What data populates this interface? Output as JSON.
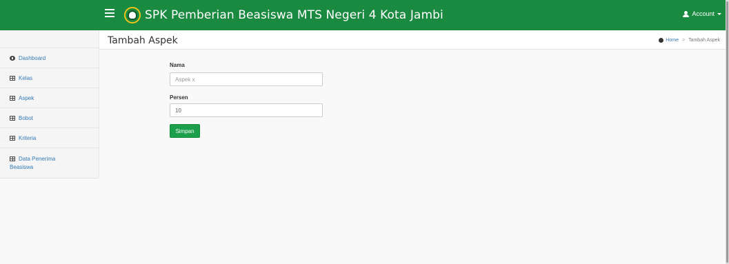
{
  "header": {
    "app_title": "SPK Pemberian Beasiswa MTS Negeri 4 Kota Jambi",
    "account_label": "Account",
    "brand_color": "#1b8a41"
  },
  "sidebar": {
    "items": [
      {
        "label": "Dashboard",
        "icon": "dashboard-icon"
      },
      {
        "label": "Kelas",
        "icon": "table-icon"
      },
      {
        "label": "Aspek",
        "icon": "table-icon"
      },
      {
        "label": "Bobot",
        "icon": "table-icon"
      },
      {
        "label": "Kriteria",
        "icon": "table-icon"
      },
      {
        "label_line1": "Data Penerima",
        "label_line2": "Beasiswa",
        "icon": "table-icon"
      }
    ]
  },
  "page": {
    "title": "Tambah Aspek",
    "breadcrumb": {
      "home": "Home",
      "separator": ">",
      "current": "Tambah Aspek"
    }
  },
  "form": {
    "nama_label": "Nama",
    "nama_placeholder": "Aspek x",
    "persen_label": "Persen",
    "persen_value": "10",
    "submit_label": "Simpan"
  }
}
